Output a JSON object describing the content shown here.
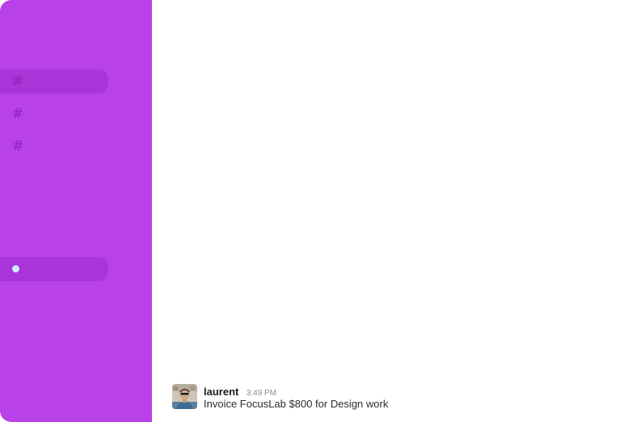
{
  "sidebar": {
    "channels": [
      {
        "icon": "hash-icon",
        "active": true
      },
      {
        "icon": "hash-icon",
        "active": false
      },
      {
        "icon": "hash-icon",
        "active": false
      }
    ],
    "direct_message": {
      "status": "online"
    }
  },
  "messages": [
    {
      "author": "laurent",
      "timestamp": "3:49 PM",
      "text": "Invoice FocusLab $800 for Design work"
    }
  ],
  "colors": {
    "sidebar_bg": "#b941e9",
    "sidebar_active": "#a934d8",
    "hash": "#8a25b8",
    "presence": "#cdeaff"
  }
}
